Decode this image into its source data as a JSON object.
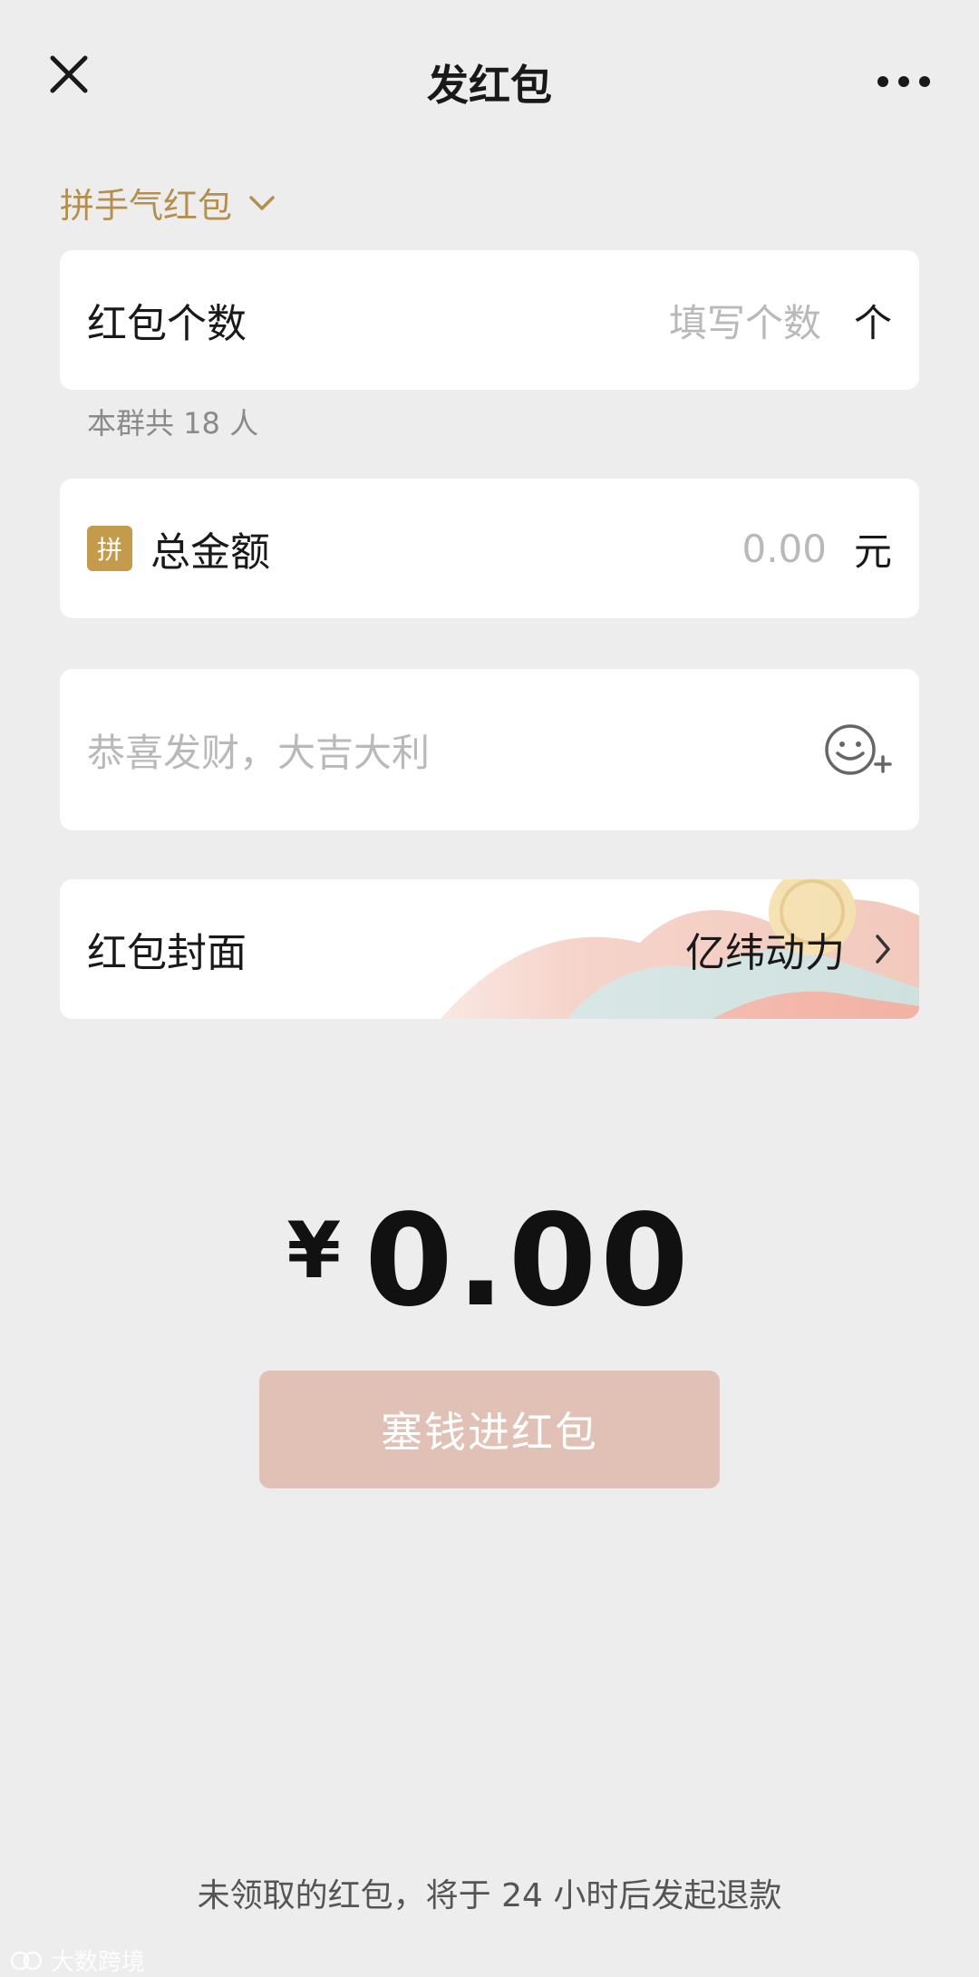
{
  "header": {
    "title": "发红包"
  },
  "type_selector": {
    "label": "拼手气红包"
  },
  "count_card": {
    "label": "红包个数",
    "placeholder": "填写个数",
    "unit": "个"
  },
  "group_hint": "本群共 18 人",
  "amount_card": {
    "badge": "拼",
    "label": "总金额",
    "placeholder": "0.00",
    "unit": "元"
  },
  "message_card": {
    "placeholder": "恭喜发财，大吉大利"
  },
  "cover_card": {
    "label": "红包封面",
    "value": "亿纬动力"
  },
  "total": {
    "currency": "¥",
    "value": "0.00"
  },
  "submit_button": "塞钱进红包",
  "refund_note": "未领取的红包，将于 24 小时后发起退款",
  "watermark": "大数跨境",
  "colors": {
    "background": "#ededed",
    "accent_gold": "#b48f4e",
    "button_disabled": "#e1c0b5",
    "badge": "#c49a4d"
  }
}
